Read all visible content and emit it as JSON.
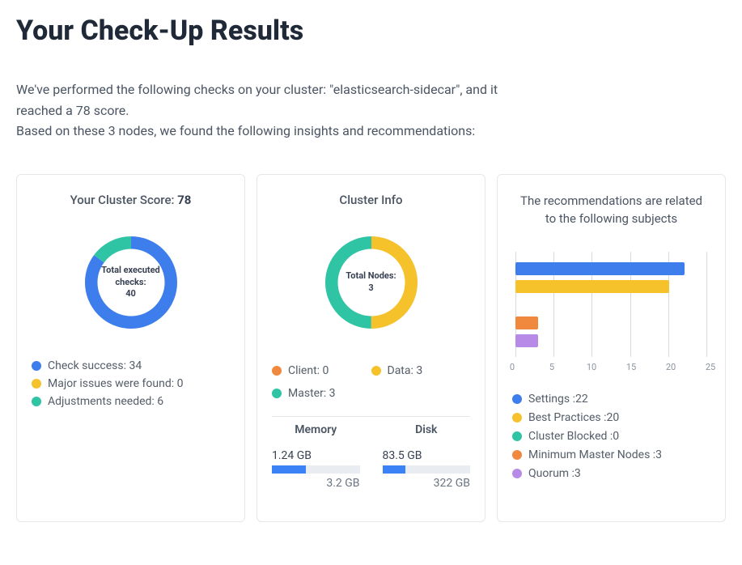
{
  "title": "Your Check-Up Results",
  "intro_line1": "We've performed the following checks on your cluster: \"elasticsearch-sidecar\", and it reached a 78 score.",
  "intro_line2": "Based on these 3 nodes, we found the following insights and recommendations:",
  "score_card": {
    "heading_prefix": "Your Cluster Score: ",
    "score": "78",
    "center_label": "Total executed checks:",
    "center_value": "40",
    "legend": [
      {
        "label": "Check success: 34",
        "color": "#3d7eec",
        "value": 34
      },
      {
        "label": "Major issues were found: 0",
        "color": "#f5c22b",
        "value": 0
      },
      {
        "label": "Adjustments needed: 6",
        "color": "#2ec4a4",
        "value": 6
      }
    ]
  },
  "cluster_card": {
    "heading": "Cluster Info",
    "center_label": "Total Nodes:",
    "center_value": "3",
    "legend": [
      {
        "label": "Client: 0",
        "color": "#f0883e",
        "value": 0
      },
      {
        "label": "Data: 3",
        "color": "#f5c22b",
        "value": 3
      },
      {
        "label": "Master: 3",
        "color": "#2ec4a4",
        "value": 3
      }
    ],
    "resources": {
      "memory": {
        "label": "Memory",
        "used": "1.24 GB",
        "total": "3.2 GB",
        "used_num": 1.24,
        "total_num": 3.2
      },
      "disk": {
        "label": "Disk",
        "used": "83.5 GB",
        "total": "322 GB",
        "used_num": 83.5,
        "total_num": 322
      }
    }
  },
  "reco_card": {
    "heading": "The recommendations are related to the following subjects",
    "x_ticks": [
      "0",
      "5",
      "10",
      "15",
      "20",
      "25"
    ],
    "x_max": 25,
    "bars": [
      {
        "label": "Settings :22",
        "value": 22,
        "color": "#3d7eec"
      },
      {
        "label": "Best Practices :20",
        "value": 20,
        "color": "#f5c22b"
      },
      {
        "label": "Cluster Blocked :0",
        "value": 0,
        "color": "#2ec4a4"
      },
      {
        "label": "Minimum Master Nodes :3",
        "value": 3,
        "color": "#f0883e"
      },
      {
        "label": "Quorum :3",
        "value": 3,
        "color": "#b88ae8"
      }
    ]
  },
  "chart_data": [
    {
      "type": "pie",
      "title": "Your Cluster Score: 78 — Total executed checks: 40",
      "series": [
        {
          "name": "Check success",
          "value": 34
        },
        {
          "name": "Major issues were found",
          "value": 0
        },
        {
          "name": "Adjustments needed",
          "value": 6
        }
      ]
    },
    {
      "type": "pie",
      "title": "Cluster Info — Total Nodes: 3",
      "series": [
        {
          "name": "Client",
          "value": 0
        },
        {
          "name": "Data",
          "value": 3
        },
        {
          "name": "Master",
          "value": 3
        }
      ]
    },
    {
      "type": "bar",
      "title": "The recommendations are related to the following subjects",
      "categories": [
        "Settings",
        "Best Practices",
        "Cluster Blocked",
        "Minimum Master Nodes",
        "Quorum"
      ],
      "values": [
        22,
        20,
        0,
        3,
        3
      ],
      "xlabel": "",
      "ylabel": "",
      "ylim": [
        0,
        25
      ]
    },
    {
      "type": "bar",
      "title": "Memory",
      "categories": [
        "used",
        "total"
      ],
      "values": [
        1.24,
        3.2
      ],
      "ylabel": "GB"
    },
    {
      "type": "bar",
      "title": "Disk",
      "categories": [
        "used",
        "total"
      ],
      "values": [
        83.5,
        322
      ],
      "ylabel": "GB"
    }
  ]
}
